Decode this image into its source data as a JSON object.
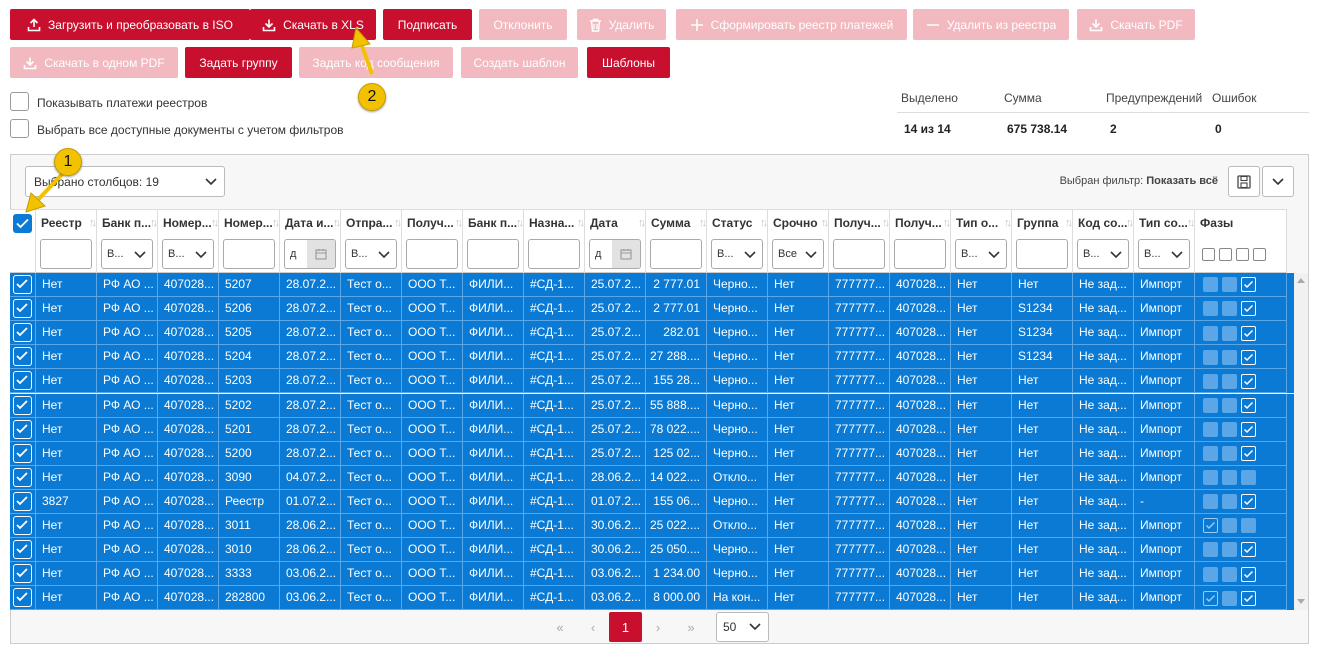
{
  "toolbar": {
    "row1": [
      {
        "label": "Загрузить и преобразовать в ISO",
        "icon": "upload-icon",
        "active": true
      },
      {
        "label": "Скачать в XLS",
        "icon": "download-icon",
        "active": true
      },
      {
        "label": "Подписать",
        "icon": "",
        "active": true
      },
      {
        "label": "Отклонить",
        "icon": "",
        "active": false
      },
      {
        "label": "Удалить",
        "icon": "trash-icon",
        "active": false
      },
      {
        "label": "Сформировать реестр платежей",
        "icon": "plus-icon",
        "active": false
      },
      {
        "label": "Удалить из реестра",
        "icon": "minus-icon",
        "active": false
      },
      {
        "label": "Скачать PDF",
        "icon": "download-icon",
        "active": false
      }
    ],
    "row2": [
      {
        "label": "Скачать в одном PDF",
        "icon": "download-icon",
        "active": false
      },
      {
        "label": "Задать группу",
        "icon": "",
        "active": true
      },
      {
        "label": "Задать код сообщения",
        "icon": "",
        "active": false
      },
      {
        "label": "Создать шаблон",
        "icon": "",
        "active": false
      },
      {
        "label": "Шаблоны",
        "icon": "",
        "active": true
      }
    ]
  },
  "options": {
    "show_registry_payments": "Показывать платежи реестров",
    "select_all_filtered": "Выбрать все доступные документы с учетом фильтров"
  },
  "summary": {
    "headers": [
      "Выделено",
      "Сумма",
      "Предупреждений",
      "Ошибок"
    ],
    "values": [
      "14 из 14",
      "675 738.14",
      "2",
      "0"
    ]
  },
  "grid": {
    "columns_selector": "Выбрано столбцов: 19",
    "filter_label": "Выбран фильтр:",
    "filter_value": "Показать всё",
    "columns": [
      "Реестр",
      "Банк п...",
      "Номер...",
      "Номер...",
      "Дата и...",
      "Отпра...",
      "Получ...",
      "Банк п...",
      "Назна...",
      "Дата",
      "Сумма",
      "Статус",
      "Срочно",
      "Получ...",
      "Получ...",
      "Тип о...",
      "Группа",
      "Код со...",
      "Тип со...",
      "Фазы"
    ],
    "filters": [
      "",
      "В...",
      "В...",
      "",
      "д",
      "В...",
      "",
      "",
      "",
      "д",
      "",
      "В...",
      "Все",
      "",
      "",
      "В...",
      "",
      "В...",
      "В...",
      ""
    ],
    "rows": [
      [
        "Нет",
        "РФ АО ...",
        "407028...",
        "5207",
        "28.07.2...",
        "Тест о...",
        "ООО Т...",
        "ФИЛИ...",
        "#СД-1...",
        "25.07.2...",
        "2 777.01",
        "Черно...",
        "Нет",
        "777777...",
        "407028...",
        "Нет",
        "Нет",
        "Не зад...",
        "Импорт"
      ],
      [
        "Нет",
        "РФ АО ...",
        "407028...",
        "5206",
        "28.07.2...",
        "Тест о...",
        "ООО Т...",
        "ФИЛИ...",
        "#СД-1...",
        "25.07.2...",
        "2 777.01",
        "Черно...",
        "Нет",
        "777777...",
        "407028...",
        "Нет",
        "S1234",
        "Не зад...",
        "Импорт"
      ],
      [
        "Нет",
        "РФ АО ...",
        "407028...",
        "5205",
        "28.07.2...",
        "Тест о...",
        "ООО Т...",
        "ФИЛИ...",
        "#СД-1...",
        "25.07.2...",
        "282.01",
        "Черно...",
        "Нет",
        "777777...",
        "407028...",
        "Нет",
        "S1234",
        "Не зад...",
        "Импорт"
      ],
      [
        "Нет",
        "РФ АО ...",
        "407028...",
        "5204",
        "28.07.2...",
        "Тест о...",
        "ООО Т...",
        "ФИЛИ...",
        "#СД-1...",
        "25.07.2...",
        "27 288....",
        "Черно...",
        "Нет",
        "777777...",
        "407028...",
        "Нет",
        "S1234",
        "Не зад...",
        "Импорт"
      ],
      [
        "Нет",
        "РФ АО ...",
        "407028...",
        "5203",
        "28.07.2...",
        "Тест о...",
        "ООО Т...",
        "ФИЛИ...",
        "#СД-1...",
        "25.07.2...",
        "155 28...",
        "Черно...",
        "Нет",
        "777777...",
        "407028...",
        "Нет",
        "Нет",
        "Не зад...",
        "Импорт"
      ],
      [
        "Нет",
        "РФ АО ...",
        "407028...",
        "5202",
        "28.07.2...",
        "Тест о...",
        "ООО Т...",
        "ФИЛИ...",
        "#СД-1...",
        "25.07.2...",
        "55 888....",
        "Черно...",
        "Нет",
        "777777...",
        "407028...",
        "Нет",
        "Нет",
        "Не зад...",
        "Импорт"
      ],
      [
        "Нет",
        "РФ АО ...",
        "407028...",
        "5201",
        "28.07.2...",
        "Тест о...",
        "ООО Т...",
        "ФИЛИ...",
        "#СД-1...",
        "25.07.2...",
        "78 022....",
        "Черно...",
        "Нет",
        "777777...",
        "407028...",
        "Нет",
        "Нет",
        "Не зад...",
        "Импорт"
      ],
      [
        "Нет",
        "РФ АО ...",
        "407028...",
        "5200",
        "28.07.2...",
        "Тест о...",
        "ООО Т...",
        "ФИЛИ...",
        "#СД-1...",
        "25.07.2...",
        "125 02...",
        "Черно...",
        "Нет",
        "777777...",
        "407028...",
        "Нет",
        "Нет",
        "Не зад...",
        "Импорт"
      ],
      [
        "Нет",
        "РФ АО ...",
        "407028...",
        "3090",
        "04.07.2...",
        "Тест о...",
        "ООО Т...",
        "ФИЛИ...",
        "#СД-1...",
        "28.06.2...",
        "14 022....",
        "Откло...",
        "Нет",
        "777777...",
        "407028...",
        "Нет",
        "Нет",
        "Не зад...",
        "Импорт"
      ],
      [
        "3827",
        "РФ АО ...",
        "407028...",
        "Реестр",
        "01.07.2...",
        "Тест о...",
        "ООО Т...",
        "ФИЛИ...",
        "#СД-1...",
        "01.07.2...",
        "155 06...",
        "Черно...",
        "Нет",
        "777777...",
        "407028...",
        "Нет",
        "Нет",
        "Не зад...",
        "-"
      ],
      [
        "Нет",
        "РФ АО ...",
        "407028...",
        "3011",
        "28.06.2...",
        "Тест о...",
        "ООО Т...",
        "ФИЛИ...",
        "#СД-1...",
        "30.06.2...",
        "25 022....",
        "Откло...",
        "Нет",
        "777777...",
        "407028...",
        "Нет",
        "Нет",
        "Не зад...",
        "Импорт"
      ],
      [
        "Нет",
        "РФ АО ...",
        "407028...",
        "3010",
        "28.06.2...",
        "Тест о...",
        "ООО Т...",
        "ФИЛИ...",
        "#СД-1...",
        "30.06.2...",
        "25 050....",
        "Черно...",
        "Нет",
        "777777...",
        "407028...",
        "Нет",
        "Нет",
        "Не зад...",
        "Импорт"
      ],
      [
        "Нет",
        "РФ АО ...",
        "407028...",
        "3333",
        "03.06.2...",
        "Тест о...",
        "ООО Т...",
        "ФИЛИ...",
        "#СД-1...",
        "03.06.2...",
        "1 234.00",
        "Черно...",
        "Нет",
        "777777...",
        "407028...",
        "Нет",
        "Нет",
        "Не зад...",
        "Импорт"
      ],
      [
        "Нет",
        "РФ АО ...",
        "407028...",
        "282800",
        "03.06.2...",
        "Тест о...",
        "ООО Т...",
        "ФИЛИ...",
        "#СД-1...",
        "03.06.2...",
        "8 000.00",
        "На кон...",
        "Нет",
        "777777...",
        "407028...",
        "Нет",
        "Нет",
        "Не зад...",
        "Импорт"
      ]
    ],
    "phases": [
      [
        "box",
        "box",
        "check"
      ],
      [
        "box",
        "box",
        "check"
      ],
      [
        "box",
        "box",
        "check"
      ],
      [
        "box",
        "box",
        "check"
      ],
      [
        "box",
        "box",
        "check"
      ],
      [
        "box",
        "box",
        "check"
      ],
      [
        "box",
        "box",
        "check"
      ],
      [
        "box",
        "box",
        "check"
      ],
      [
        "box",
        "box",
        "box"
      ],
      [
        "box",
        "box",
        "check"
      ],
      [
        "lite",
        "box",
        "box"
      ],
      [
        "box",
        "box",
        "check"
      ],
      [
        "box",
        "box",
        "check"
      ],
      [
        "lite",
        "box",
        "check"
      ]
    ]
  },
  "pagination": {
    "current": "1",
    "page_size": "50"
  },
  "annotations": [
    "1",
    "2"
  ]
}
